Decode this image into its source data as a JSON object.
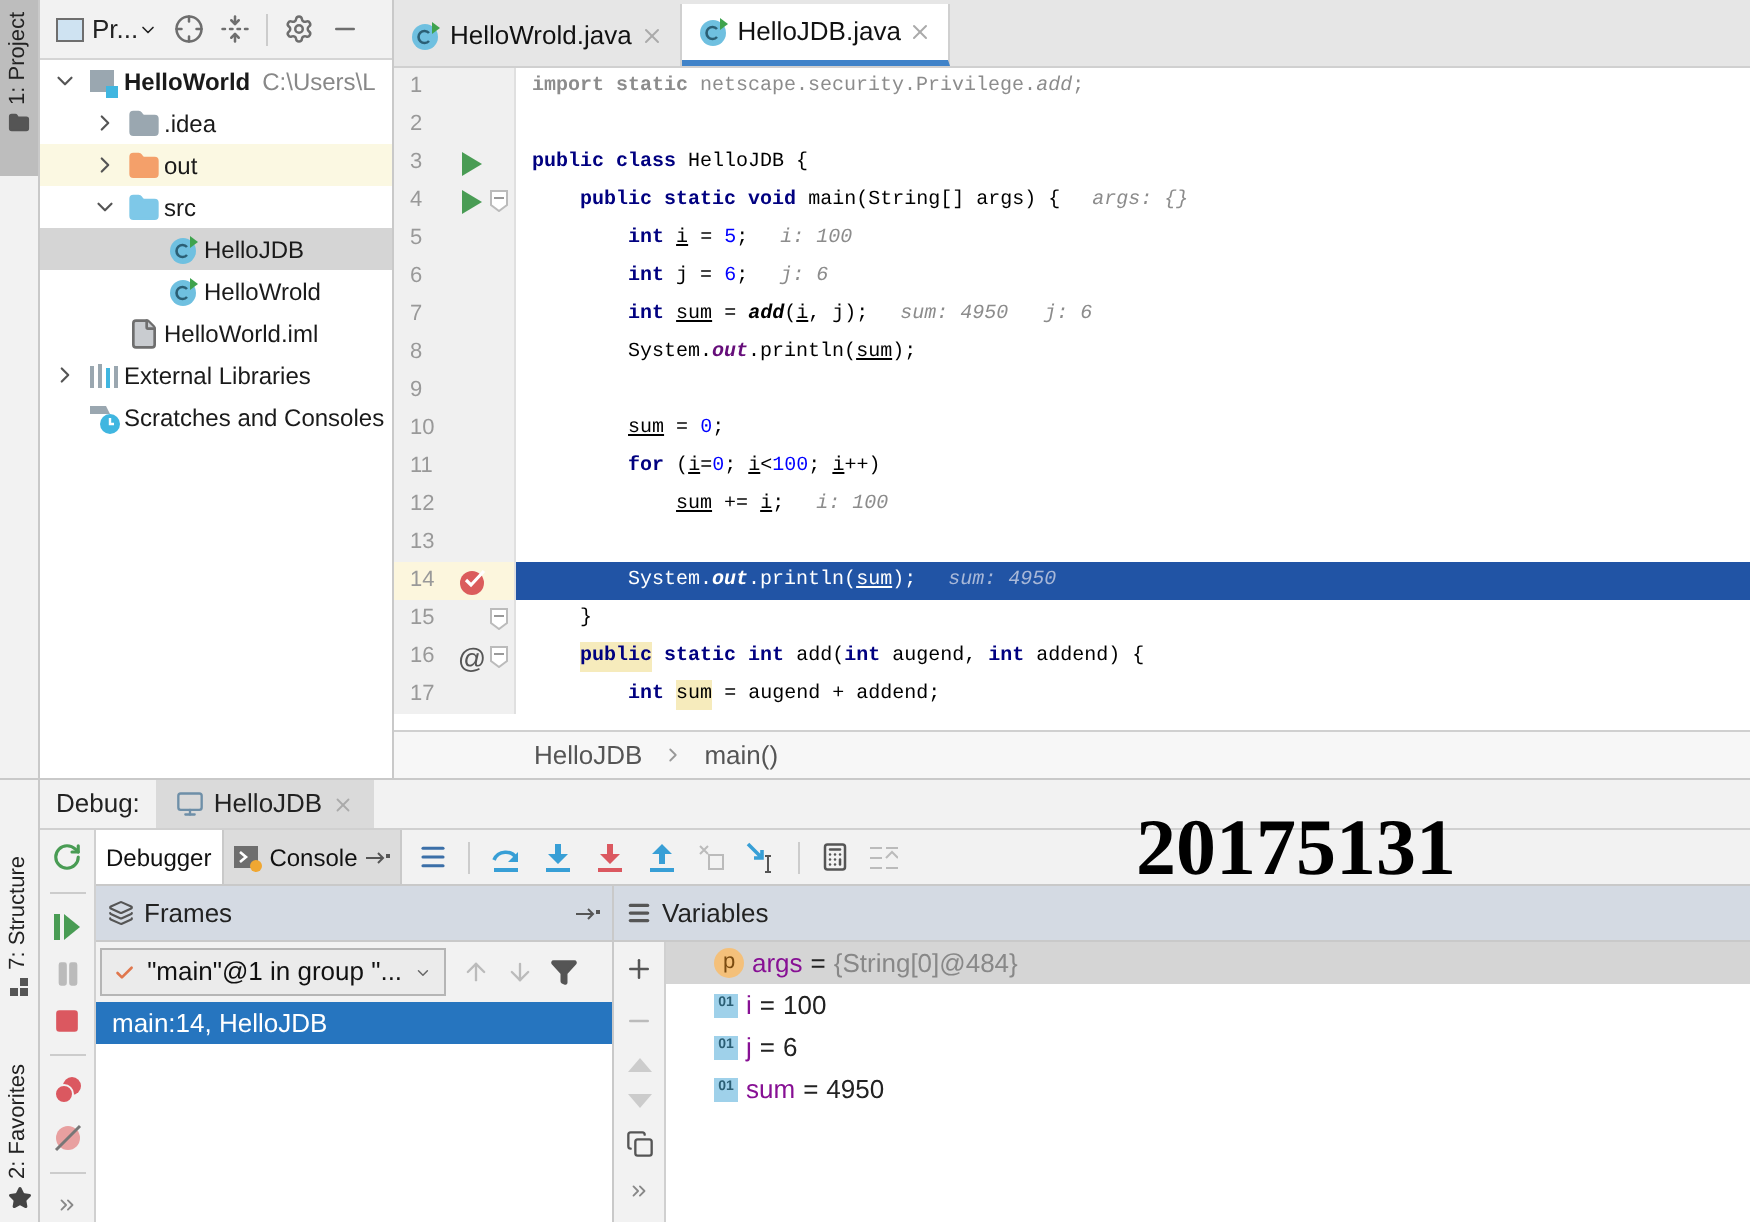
{
  "left_stripe_top": {
    "tab": "1: Project"
  },
  "project": {
    "view_selector": "Pr...",
    "tree": [
      {
        "label": "HelloWorld",
        "path": "C:\\Users\\L",
        "kind": "module",
        "expanded": true,
        "selected": false,
        "children": [
          {
            "label": ".idea",
            "kind": "folder",
            "expanded": false,
            "selected": false
          },
          {
            "label": "out",
            "kind": "folder-excluded",
            "expanded": false,
            "selected": false
          },
          {
            "label": "src",
            "kind": "folder-source",
            "expanded": true,
            "selected": false,
            "children": [
              {
                "label": "HelloJDB",
                "kind": "class",
                "selected": true
              },
              {
                "label": "HelloWrold",
                "kind": "class",
                "selected": false
              }
            ]
          },
          {
            "label": "HelloWorld.iml",
            "kind": "iml",
            "selected": false
          }
        ]
      },
      {
        "label": "External Libraries",
        "kind": "libraries",
        "expanded": false,
        "selected": false
      },
      {
        "label": "Scratches and Consoles",
        "kind": "scratches",
        "selected": false
      }
    ]
  },
  "editor": {
    "tabs": [
      {
        "label": "HelloWrold.java",
        "selected": false
      },
      {
        "label": "HelloJDB.java",
        "selected": true
      }
    ],
    "lines": [
      {
        "number": "1",
        "current": false,
        "tokens": [
          {
            "text": "import static",
            "kind": "unused-kw"
          },
          {
            "text": " netscape.security.Privilege.",
            "kind": "unused"
          },
          {
            "text": "add",
            "kind": "unused-italic"
          },
          {
            "text": ";",
            "kind": "unused"
          }
        ]
      },
      {
        "number": "2",
        "current": false
      },
      {
        "number": "3",
        "current": false,
        "gutter": {
          "kind": "run"
        },
        "tokens": [
          {
            "text": "public class",
            "kind": "kw"
          },
          {
            "text": " HelloJDB {",
            "kind": "plain"
          }
        ]
      },
      {
        "number": "4",
        "current": false,
        "gutter": {
          "kind": "run"
        },
        "fold": true,
        "tokens": [
          {
            "text": "    public static void",
            "kind": "kw"
          },
          {
            "text": " main(String[] args) {",
            "kind": "plain"
          },
          {
            "text": "args: {}",
            "kind": "hint"
          }
        ]
      },
      {
        "number": "5",
        "current": false,
        "tokens": [
          {
            "text": "        int",
            "kind": "kw"
          },
          {
            "text": " i",
            "kind": "var"
          },
          {
            "text": " = ",
            "kind": "plain"
          },
          {
            "text": "5",
            "kind": "num"
          },
          {
            "text": ";",
            "kind": "plain"
          },
          {
            "text": "i: 100",
            "kind": "hint"
          }
        ]
      },
      {
        "number": "6",
        "current": false,
        "tokens": [
          {
            "text": "        int",
            "kind": "kw"
          },
          {
            "text": " j = ",
            "kind": "plain"
          },
          {
            "text": "6",
            "kind": "num"
          },
          {
            "text": ";",
            "kind": "plain"
          },
          {
            "text": "j: 6",
            "kind": "hint"
          }
        ]
      },
      {
        "number": "7",
        "current": false,
        "tokens": [
          {
            "text": "        int",
            "kind": "kw"
          },
          {
            "text": " sum",
            "kind": "var"
          },
          {
            "text": " = ",
            "kind": "plain"
          },
          {
            "text": "add",
            "kind": "italic"
          },
          {
            "text": "(",
            "kind": "plain"
          },
          {
            "text": "i",
            "kind": "var"
          },
          {
            "text": ", j);",
            "kind": "plain"
          },
          {
            "text": "sum: 4950   j: 6",
            "kind": "hint"
          }
        ]
      },
      {
        "number": "8",
        "current": false,
        "tokens": [
          {
            "text": "        System.",
            "kind": "plain"
          },
          {
            "text": "out",
            "kind": "static"
          },
          {
            "text": ".println(",
            "kind": "plain"
          },
          {
            "text": "sum",
            "kind": "var"
          },
          {
            "text": ");",
            "kind": "plain"
          }
        ]
      },
      {
        "number": "9",
        "current": false
      },
      {
        "number": "10",
        "current": false,
        "tokens": [
          {
            "text": "        sum",
            "kind": "var"
          },
          {
            "text": " = ",
            "kind": "plain"
          },
          {
            "text": "0",
            "kind": "num"
          },
          {
            "text": ";",
            "kind": "plain"
          }
        ]
      },
      {
        "number": "11",
        "current": false,
        "tokens": [
          {
            "text": "        for",
            "kind": "kw"
          },
          {
            "text": " (",
            "kind": "plain"
          },
          {
            "text": "i",
            "kind": "var"
          },
          {
            "text": "=",
            "kind": "plain"
          },
          {
            "text": "0",
            "kind": "num"
          },
          {
            "text": "; ",
            "kind": "plain"
          },
          {
            "text": "i",
            "kind": "var"
          },
          {
            "text": "<",
            "kind": "plain"
          },
          {
            "text": "100",
            "kind": "num"
          },
          {
            "text": "; ",
            "kind": "plain"
          },
          {
            "text": "i",
            "kind": "var"
          },
          {
            "text": "++)",
            "kind": "plain"
          }
        ]
      },
      {
        "number": "12",
        "current": false,
        "tokens": [
          {
            "text": "            sum",
            "kind": "var"
          },
          {
            "text": " += ",
            "kind": "plain"
          },
          {
            "text": "i",
            "kind": "var"
          },
          {
            "text": ";",
            "kind": "plain"
          },
          {
            "text": "i: 100",
            "kind": "hint"
          }
        ]
      },
      {
        "number": "13",
        "current": false
      },
      {
        "number": "14",
        "current": true,
        "gutter": {
          "kind": "breakpoint"
        },
        "tokens": [
          {
            "text": "        System.",
            "kind": "plain"
          },
          {
            "text": "out",
            "kind": "static"
          },
          {
            "text": ".println(",
            "kind": "plain"
          },
          {
            "text": "sum",
            "kind": "var"
          },
          {
            "text": ");",
            "kind": "plain"
          },
          {
            "text": "sum: 4950",
            "kind": "hint"
          }
        ]
      },
      {
        "number": "15",
        "current": false,
        "fold": true,
        "tokens": [
          {
            "text": "    }",
            "kind": "plain"
          }
        ]
      },
      {
        "number": "16",
        "current": false,
        "gutter": {
          "kind": "mark",
          "text": "@"
        },
        "fold": true,
        "tokens": [
          {
            "text": "    public",
            "kind": "kw-marked"
          },
          {
            "text": " static int",
            "kind": "kw"
          },
          {
            "text": " add(",
            "kind": "plain"
          },
          {
            "text": "int",
            "kind": "kw"
          },
          {
            "text": " augend, ",
            "kind": "plain"
          },
          {
            "text": "int",
            "kind": "kw"
          },
          {
            "text": " addend) {",
            "kind": "plain"
          }
        ]
      },
      {
        "number": "17",
        "current": false,
        "tokens": [
          {
            "text": "        int",
            "kind": "kw"
          },
          {
            "text": " sum",
            "kind": "marked"
          },
          {
            "text": " = augend + addend;",
            "kind": "plain"
          }
        ]
      }
    ],
    "breadcrumb": [
      "HelloJDB",
      "main()"
    ]
  },
  "left_stripe_bottom": {
    "tabs": [
      "7: Structure",
      "2: Favorites"
    ]
  },
  "debug": {
    "title": "Debug:",
    "session": "HelloJDB",
    "tabs": [
      {
        "label": "Debugger",
        "selected": true
      },
      {
        "label": "Console",
        "selected": false
      }
    ],
    "frames": {
      "title": "Frames",
      "thread": "\"main\"@1 in group \"...",
      "items": [
        {
          "label": "main:14, HelloJDB",
          "selected": true
        }
      ]
    },
    "variables": {
      "title": "Variables",
      "items": [
        {
          "kind": "param",
          "badge": "p",
          "name": "args",
          "operator": "=",
          "value": "{String[0]@484}",
          "selected": true
        },
        {
          "kind": "local",
          "badge": "01",
          "name": "i",
          "operator": "=",
          "value": "100",
          "selected": false
        },
        {
          "kind": "local",
          "badge": "01",
          "name": "j",
          "operator": "=",
          "value": "6",
          "selected": false
        },
        {
          "kind": "local",
          "badge": "01",
          "name": "sum",
          "operator": "=",
          "value": "4950",
          "selected": false
        }
      ]
    }
  },
  "overlay_text": "20175131"
}
